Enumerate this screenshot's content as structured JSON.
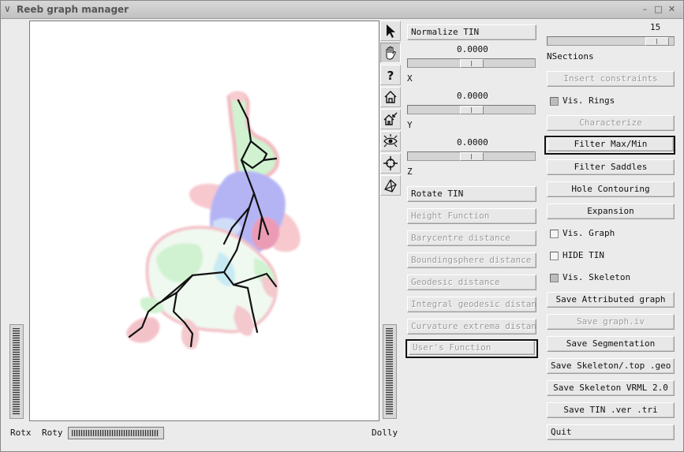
{
  "window": {
    "title": "Reeb graph manager"
  },
  "viewer": {
    "labels": {
      "rotx": "Rotx",
      "roty": "Roty",
      "dolly": "Dolly"
    }
  },
  "tools": [
    {
      "name": "select-arrow-icon",
      "active": false
    },
    {
      "name": "pan-hand-icon",
      "active": true
    },
    {
      "name": "help-question-icon",
      "active": false
    },
    {
      "name": "home-icon",
      "active": false
    },
    {
      "name": "set-home-icon",
      "active": false
    },
    {
      "name": "view-all-eye-icon",
      "active": false
    },
    {
      "name": "seek-crosshair-icon",
      "active": false
    },
    {
      "name": "projection-cube-icon",
      "active": false
    }
  ],
  "middle": {
    "normalize_label": "Normalize TIN",
    "x_value": "0.0000",
    "x_label": "X",
    "y_value": "0.0000",
    "y_label": "Y",
    "z_value": "0.0000",
    "z_label": "Z",
    "rotate_label": "Rotate TIN",
    "functions": [
      "Height Function",
      "Barycentre distance",
      "Boundingsphere distance",
      "Geodesic distance",
      "Integral geodesic distance",
      "Curvature extrema distance",
      "User's Function"
    ]
  },
  "right": {
    "nsections_value": "15",
    "nsections_label": "NSections",
    "insert_constraints": "Insert constraints",
    "vis_rings": "Vis. Rings",
    "characterize": "Characterize",
    "filter_maxmin": "Filter Max/Min",
    "filter_saddles": "Filter Saddles",
    "hole_contouring": "Hole Contouring",
    "expansion": "Expansion",
    "vis_graph": "Vis. Graph",
    "hide_tin": "HIDE TIN",
    "vis_skeleton": "Vis. Skeleton",
    "save_attributed": "Save Attributed graph",
    "save_graph_iv": "Save graph.iv",
    "save_segmentation": "Save Segmentation",
    "save_skeleton_top": "Save Skeleton/.top .geo",
    "save_skeleton_vrml": "Save Skeleton VRML 2.0",
    "save_tin": "Save TIN .ver .tri",
    "quit": "Quit"
  },
  "checkbox_state": {
    "vis_rings": true,
    "vis_graph": false,
    "hide_tin": false,
    "vis_skeleton": true
  },
  "colors": {
    "background": "#ebebeb",
    "viewer_bg": "#ffffff",
    "mesh_green": "#b8ecb8",
    "mesh_pink": "#f4b8c0",
    "mesh_blue": "#8c8cf0",
    "skeleton": "#111111"
  }
}
